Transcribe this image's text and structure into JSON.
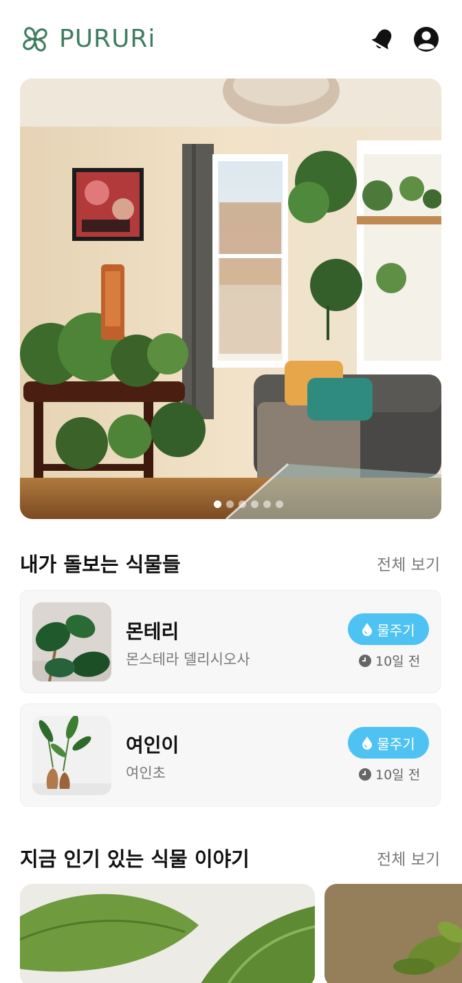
{
  "header": {
    "logo_text": "PURURi",
    "logo_icon": "leaf-spiral-icon",
    "notification_icon": "bell-icon",
    "profile_icon": "user-circle-icon"
  },
  "hero": {
    "slide_count": 6,
    "active_index": 0
  },
  "my_plants": {
    "title": "내가 돌보는 식물들",
    "see_all": "전체 보기",
    "items": [
      {
        "name": "몬테리",
        "species": "몬스테라 델리시오사",
        "water_label": "물주기",
        "last_watered": "10일 전"
      },
      {
        "name": "여인이",
        "species": "여인초",
        "water_label": "물주기",
        "last_watered": "10일 전"
      }
    ]
  },
  "popular_stories": {
    "title": "지금 인기 있는 식물 이야기",
    "see_all": "전체 보기"
  },
  "colors": {
    "brand": "#3f7d62",
    "water_button": "#4ec3f3"
  }
}
